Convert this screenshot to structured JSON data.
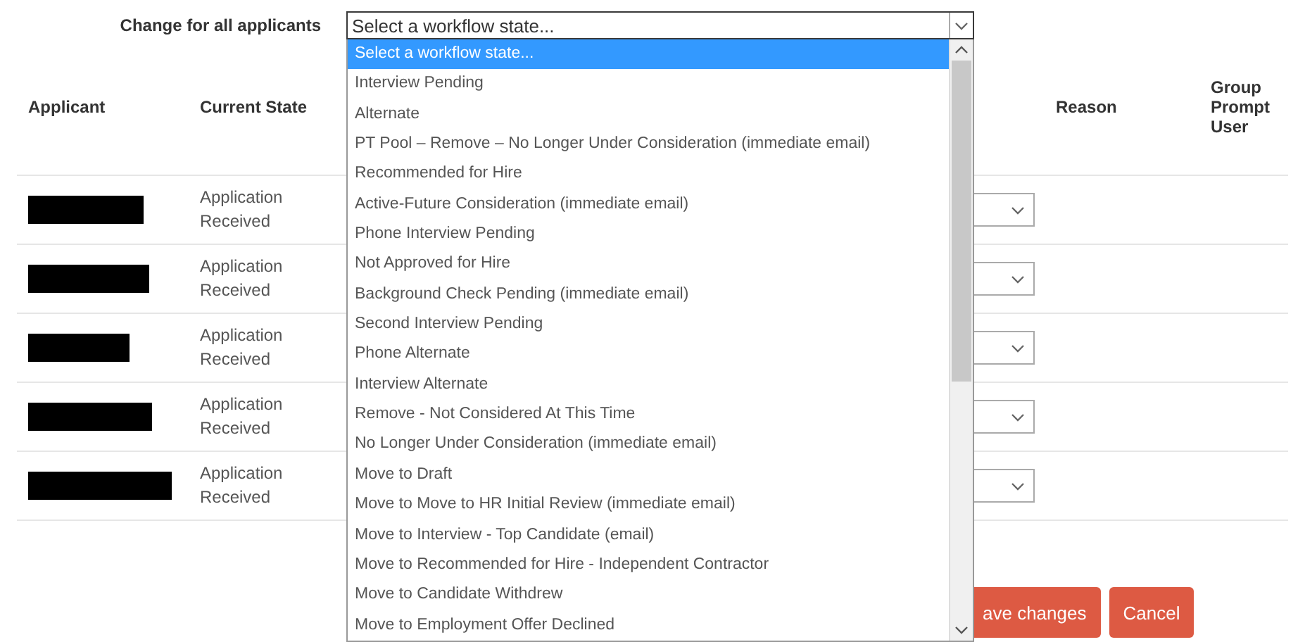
{
  "bulk_change": {
    "label": "Change for all applicants",
    "placeholder": "Select a workflow state...",
    "options": [
      {
        "label": "Select a workflow state...",
        "selected": true
      },
      {
        "label": "Interview Pending",
        "selected": false
      },
      {
        "label": "Alternate",
        "selected": false
      },
      {
        "label": "PT Pool – Remove – No Longer Under Consideration (immediate email)",
        "selected": false
      },
      {
        "label": "Recommended for Hire",
        "selected": false
      },
      {
        "label": "Active-Future Consideration (immediate email)",
        "selected": false
      },
      {
        "label": "Phone Interview Pending",
        "selected": false
      },
      {
        "label": "Not Approved for Hire",
        "selected": false
      },
      {
        "label": "Background Check Pending (immediate email)",
        "selected": false
      },
      {
        "label": "Second Interview Pending",
        "selected": false
      },
      {
        "label": "Phone Alternate",
        "selected": false
      },
      {
        "label": "Interview Alternate",
        "selected": false
      },
      {
        "label": "Remove - Not Considered At This Time",
        "selected": false
      },
      {
        "label": "No Longer Under Consideration (immediate email)",
        "selected": false
      },
      {
        "label": "Move to Draft",
        "selected": false
      },
      {
        "label": "Move to Move to HR Initial Review (immediate email)",
        "selected": false
      },
      {
        "label": "Move to Interview - Top Candidate (email)",
        "selected": false
      },
      {
        "label": "Move to Recommended for Hire - Independent Contractor",
        "selected": false
      },
      {
        "label": "Move to Candidate Withdrew",
        "selected": false
      },
      {
        "label": "Move to Employment Offer Declined",
        "selected": false
      }
    ]
  },
  "table": {
    "columns": [
      "Applicant",
      "Current State",
      "Reason",
      "Group Prompt User"
    ],
    "rows": [
      {
        "applicant_redacted": true,
        "current_state": "Application Received"
      },
      {
        "applicant_redacted": true,
        "current_state": "Application Received"
      },
      {
        "applicant_redacted": true,
        "current_state": "Application Received"
      },
      {
        "applicant_redacted": true,
        "current_state": "Application Received"
      },
      {
        "applicant_redacted": true,
        "current_state": "Application Received"
      }
    ]
  },
  "buttons": [
    "ave changes",
    "Cancel"
  ]
}
